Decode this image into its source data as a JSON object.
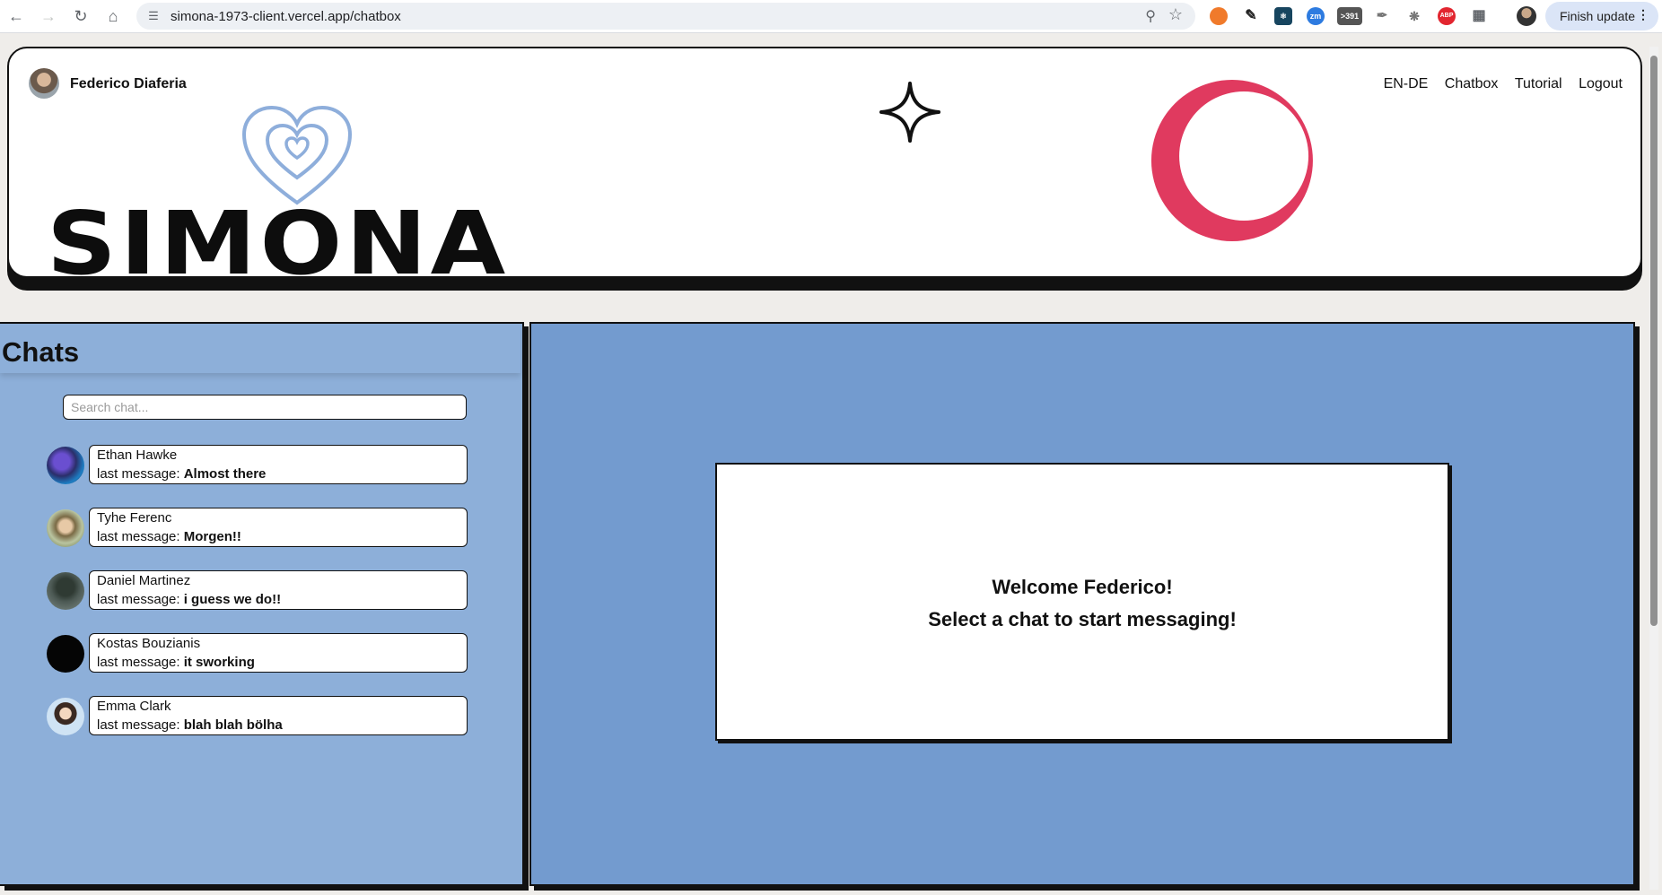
{
  "browser": {
    "url": "simona-1973-client.vercel.app/chatbox",
    "finish_update": "Finish update",
    "extensions": [
      "ext-orange",
      "ext-pen",
      "ext-react",
      "ext-zm",
      "ext-391",
      "ext-feather",
      "ext-bug",
      "ext-abp",
      "ext-puzzle"
    ],
    "ext_badge": ">391",
    "ext_zm": "zm",
    "ext_abp": "ABP"
  },
  "header": {
    "user_name": "Federico Diaferia",
    "nav": [
      "EN-DE",
      "Chatbox",
      "Tutorial",
      "Logout"
    ],
    "logo_text": "SIMONA"
  },
  "chats": {
    "title": "Chats",
    "search_placeholder": "Search chat...",
    "prefix": "last message: ",
    "items": [
      {
        "name": "Ethan Hawke",
        "last": "Almost there"
      },
      {
        "name": "Tyhe Ferenc",
        "last": "Morgen!!"
      },
      {
        "name": "Daniel Martinez",
        "last": "i guess we do!!"
      },
      {
        "name": "Kostas Bouzianis",
        "last": "it sworking"
      },
      {
        "name": "Emma Clark",
        "last": "blah blah bölha"
      }
    ]
  },
  "main": {
    "welcome": "Welcome Federico!",
    "instruction": "Select a chat to start messaging!"
  },
  "colors": {
    "chat_panel": "#8dafd9",
    "main_panel": "#739bcf",
    "heart": "#8eaedb",
    "ring": "#e03a5f"
  }
}
